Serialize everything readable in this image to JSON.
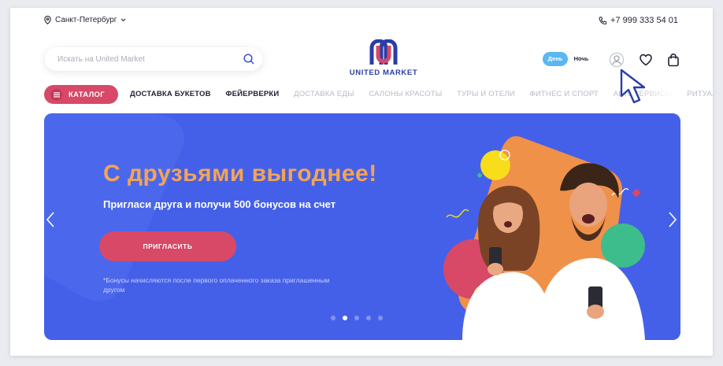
{
  "topbar": {
    "city": "Санкт-Петербург",
    "phone": "+7 999 333 54 01"
  },
  "search": {
    "placeholder": "Искать на United Market"
  },
  "logo": {
    "brand": "UNITED MARKET"
  },
  "theme": {
    "day_label": "День",
    "night_label": "Ночь",
    "selected": "День"
  },
  "nav": {
    "catalog_label": "КАТАЛОГ",
    "links": [
      "ДОСТАВКА БУКЕТОВ",
      "ФЕЙЕРВЕРКИ",
      "ДОСТАВКА ЕДЫ",
      "САЛОНЫ КРАСОТЫ",
      "ТУРЫ И ОТЕЛИ",
      "ФИТНЕС И СПОРТ",
      "АВТОСЕРВИСЫ",
      "РИТУАЛЬНЫЕ"
    ]
  },
  "banner": {
    "headline": "С друзьями выгоднее!",
    "subtitle": "Пригласи друга и получи 500 бонусов на счет",
    "button": "ПРИГЛАСИТЬ",
    "note": "*Бонусы начисляются после первого оплаченного заказа приглашенным другом",
    "slides_total": 5,
    "active_slide": 2
  },
  "colors": {
    "brand_blue": "#2a3ea6",
    "brand_red": "#d74967",
    "banner_bg": "#4560e8",
    "headline": "#f2a457",
    "day_toggle": "#5ab7f2"
  }
}
